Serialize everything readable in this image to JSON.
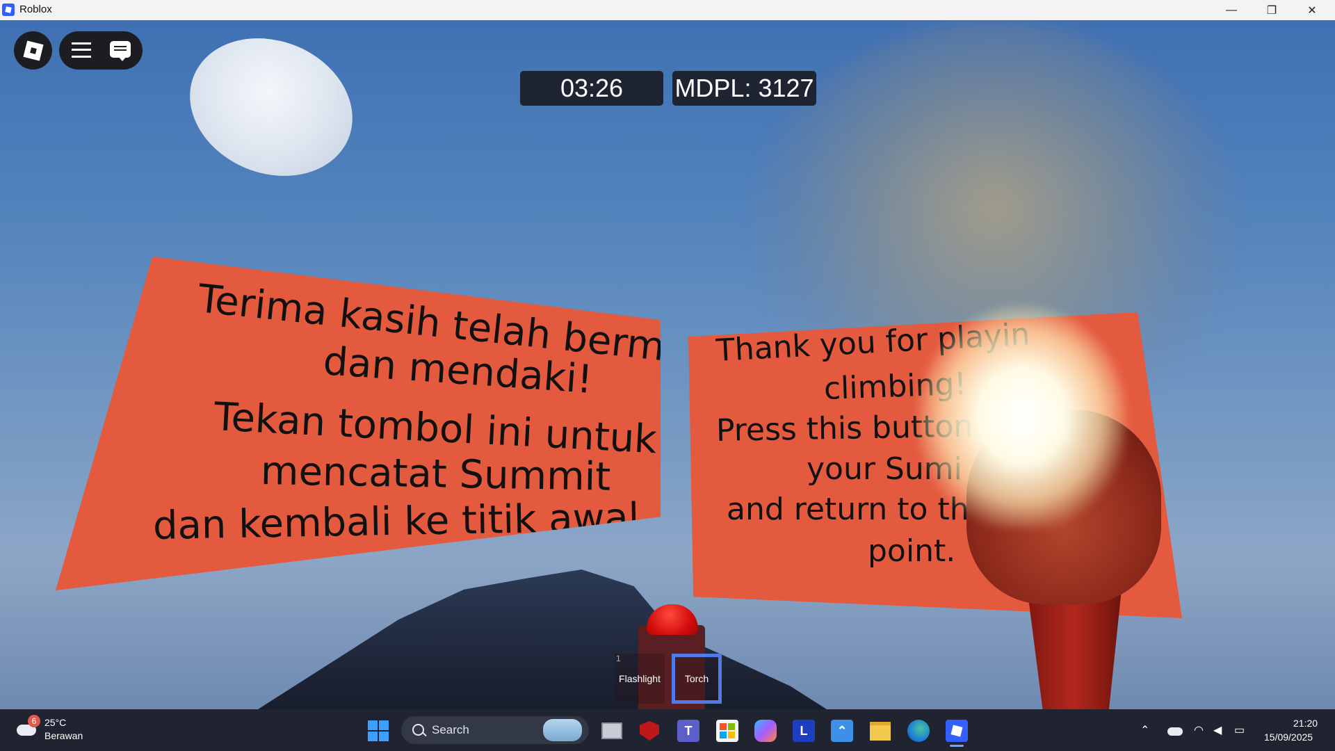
{
  "window": {
    "title": "Roblox",
    "minimize": "—",
    "restore": "❐",
    "close": "✕"
  },
  "hud": {
    "timer": "03:26",
    "altitude": "MDPL: 3127"
  },
  "sign_id": {
    "lines": [
      "Terima kasih telah bermain",
      "dan mendaki!",
      "Tekan tombol ini untuk",
      "mencatat Summit",
      "dan kembali ke titik awal."
    ]
  },
  "sign_en": {
    "lines": [
      "Thank you for playin",
      "climbing!",
      "Press this button",
      "your Sumi",
      "and return to the",
      "point."
    ]
  },
  "hotbar": {
    "slot1_number": "1",
    "slot1_label": "Flashlight",
    "slot2_label": "Torch"
  },
  "taskbar": {
    "weather_temp": "25°C",
    "weather_desc": "Berawan",
    "weather_badge": "6",
    "search_placeholder": "Search",
    "time": "21:20",
    "date": "15/09/2025",
    "pinned_apps": [
      "windows-start",
      "task-view",
      "mcafee",
      "teams",
      "microsoft-store",
      "copilot",
      "l-app",
      "app-launcher",
      "file-explorer",
      "edge",
      "roblox"
    ]
  },
  "colors": {
    "sign": "#e45a3f",
    "hud_box": "#1e2432",
    "selected_slot": "#4f7ae8",
    "taskbar": "#1f2430"
  }
}
